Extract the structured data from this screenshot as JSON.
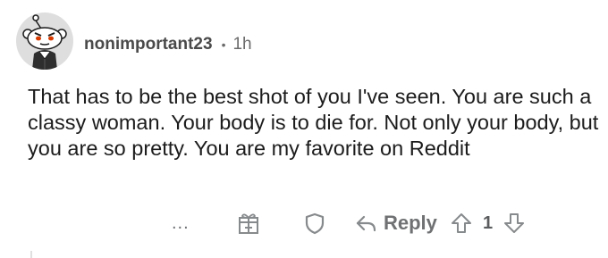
{
  "comment": {
    "username": "nonimportant23",
    "separator": "•",
    "time": "1h",
    "text": "That has to be the best shot of you I've seen. You are such a classy woman. Your body is to die for. Not only your body, but you are so pretty. You are my favorite on Reddit",
    "avatar_icon": "snoo-avatar-icon"
  },
  "actions": {
    "more_label": "...",
    "award_icon": "gift-icon",
    "share_icon": "shield-icon",
    "reply_icon": "reply-arrow-icon",
    "reply_label": "Reply",
    "upvote_icon": "upvote-icon",
    "score": "1",
    "downvote_icon": "downvote-icon"
  },
  "colors": {
    "text": "#1c1c1c",
    "meta": "#5e5e5e",
    "icon": "#878a8c",
    "avatar_bg": "#dedede",
    "avatar_eyes": "#d93a00"
  }
}
